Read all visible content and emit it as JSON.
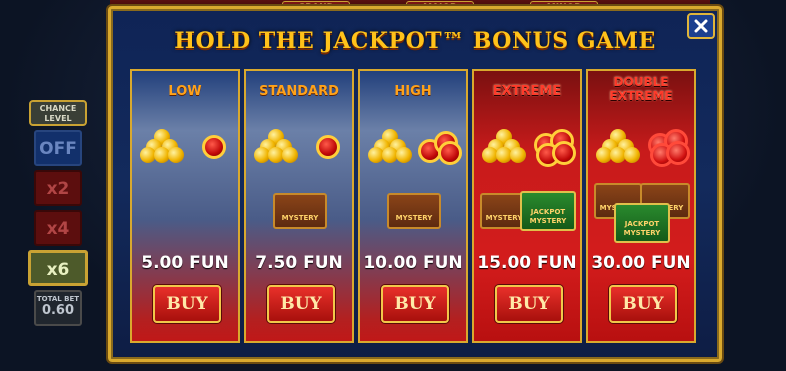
{
  "background": {
    "top_labels": [
      "GRAND",
      "MAJOR",
      "MINOR"
    ],
    "chance_level": {
      "header": "CHANCE LEVEL",
      "options": [
        "OFF",
        "x2",
        "x4",
        "x6"
      ],
      "selected": "x6"
    },
    "total_bet": {
      "label": "TOTAL BET",
      "value": "0.60"
    }
  },
  "popup": {
    "title": "HOLD THE JACKPOT™ BONUS GAME",
    "close_icon": "close-x-icon",
    "buy_label": "BUY",
    "mystery_label": "MYSTERY",
    "jackpot_mystery_label": "JACKPOT MYSTERY",
    "options": [
      {
        "name": "LOW",
        "price": "5.00 FUN",
        "coins": 3,
        "red_orbs": 1,
        "mystery": 0,
        "jackpot_mystery": 0
      },
      {
        "name": "STANDARD",
        "price": "7.50 FUN",
        "coins": 3,
        "red_orbs": 1,
        "mystery": 1,
        "jackpot_mystery": 0
      },
      {
        "name": "HIGH",
        "price": "10.00 FUN",
        "coins": 3,
        "red_orbs": 2,
        "mystery": 1,
        "jackpot_mystery": 0
      },
      {
        "name": "EXTREME",
        "price": "15.00 FUN",
        "coins": 3,
        "red_orbs": 3,
        "mystery": 1,
        "jackpot_mystery": 1
      },
      {
        "name": "DOUBLE EXTREME",
        "price": "30.00 FUN",
        "coins": 3,
        "red_orbs": 3,
        "mystery": 2,
        "jackpot_mystery": 1
      }
    ]
  },
  "colors": {
    "gold": "#ffc21a",
    "red": "#d31c1c",
    "blue": "#132a5c"
  }
}
